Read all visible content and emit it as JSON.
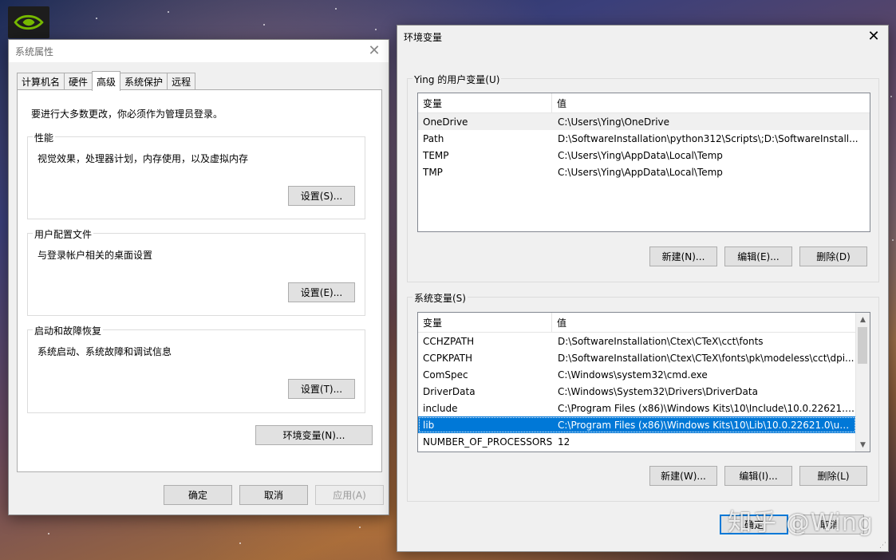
{
  "desktop": {
    "icon": "nvidia-logo-icon"
  },
  "system_properties": {
    "title": "系统属性",
    "tabs": [
      "计算机名",
      "硬件",
      "高级",
      "系统保护",
      "远程"
    ],
    "active_tab": "高级",
    "admin_note": "要进行大多数更改，你必须作为管理员登录。",
    "performance": {
      "title": "性能",
      "desc": "视觉效果，处理器计划，内存使用，以及虚拟内存",
      "button": "设置(S)..."
    },
    "user_profiles": {
      "title": "用户配置文件",
      "desc": "与登录帐户相关的桌面设置",
      "button": "设置(E)..."
    },
    "startup_recovery": {
      "title": "启动和故障恢复",
      "desc": "系统启动、系统故障和调试信息",
      "button": "设置(T)..."
    },
    "env_button": "环境变量(N)...",
    "ok": "确定",
    "cancel": "取消",
    "apply": "应用(A)"
  },
  "env_vars": {
    "title": "环境变量",
    "user_section": {
      "title": "Ying 的用户变量(U)",
      "headers": [
        "变量",
        "值"
      ],
      "rows": [
        [
          "OneDrive",
          "C:\\Users\\Ying\\OneDrive"
        ],
        [
          "Path",
          "D:\\SoftwareInstallation\\python312\\Scripts\\;D:\\SoftwareInstall..."
        ],
        [
          "TEMP",
          "C:\\Users\\Ying\\AppData\\Local\\Temp"
        ],
        [
          "TMP",
          "C:\\Users\\Ying\\AppData\\Local\\Temp"
        ]
      ],
      "new": "新建(N)...",
      "edit": "编辑(E)...",
      "delete": "删除(D)"
    },
    "system_section": {
      "title": "系统变量(S)",
      "headers": [
        "变量",
        "值"
      ],
      "rows": [
        [
          "CCHZPATH",
          "D:\\SoftwareInstallation\\Ctex\\CTeX\\cct\\fonts"
        ],
        [
          "CCPKPATH",
          "D:\\SoftwareInstallation\\Ctex\\CTeX\\fonts\\pk\\modeless\\cct\\dpi..."
        ],
        [
          "ComSpec",
          "C:\\Windows\\system32\\cmd.exe"
        ],
        [
          "DriverData",
          "C:\\Windows\\System32\\Drivers\\DriverData"
        ],
        [
          "include",
          "C:\\Program Files (x86)\\Windows Kits\\10\\Include\\10.0.22621.0..."
        ],
        [
          "lib",
          "C:\\Program Files (x86)\\Windows Kits\\10\\Lib\\10.0.22621.0\\um\\..."
        ],
        [
          "NUMBER_OF_PROCESSORS",
          "12"
        ]
      ],
      "selected_row": "lib",
      "new": "新建(W)...",
      "edit": "编辑(I)...",
      "delete": "删除(L)"
    },
    "ok": "确定",
    "cancel": "取消"
  },
  "watermark": "知乎 @Wing",
  "colors": {
    "selection": "#0078d7",
    "hover_row": "#e5f3ff",
    "dialog_bg": "#f0f0f0"
  }
}
